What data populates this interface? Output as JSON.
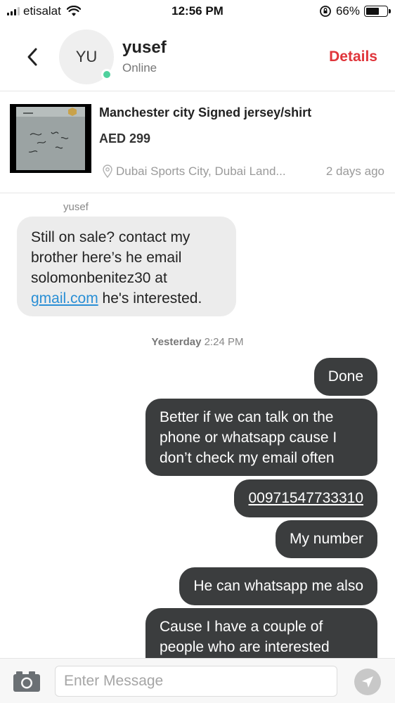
{
  "status_bar": {
    "carrier": "etisalat",
    "time": "12:56 PM",
    "battery": "66%",
    "battery_level": 0.66
  },
  "header": {
    "avatar_initials": "YU",
    "user_name": "yusef",
    "user_status": "Online",
    "details_label": "Details",
    "accent_color": "#e0353b",
    "online_color": "#4fd19d"
  },
  "listing": {
    "title": "Manchester city Signed jersey/shirt",
    "price": "AED 299",
    "location": "Dubai Sports City, Dubai Land...",
    "age": "2 days ago"
  },
  "chat": {
    "incoming_sender": "yusef",
    "incoming": {
      "line1": "Still on sale? contact my",
      "line2": "brother here’s he email",
      "line3": "solomonbenitez30 at",
      "link": "gmail.com",
      "line4_rest": " he's interested."
    },
    "divider_day": "Yesterday",
    "divider_time": "2:24 PM",
    "outgoing": [
      {
        "text": "Done"
      },
      {
        "lines": [
          "Better if we can talk on the",
          "phone or whatsapp cause I",
          "don’t check my email often"
        ]
      },
      {
        "text": "00971547733310"
      },
      {
        "text": "My number"
      },
      {
        "text": "He can whatsapp me also"
      },
      {
        "lines": [
          "Cause I have a couple of",
          "people who are interested"
        ]
      }
    ]
  },
  "composer": {
    "placeholder": "Enter Message",
    "camera_icon": "camera-icon",
    "send_icon": "send-arrow-icon"
  }
}
